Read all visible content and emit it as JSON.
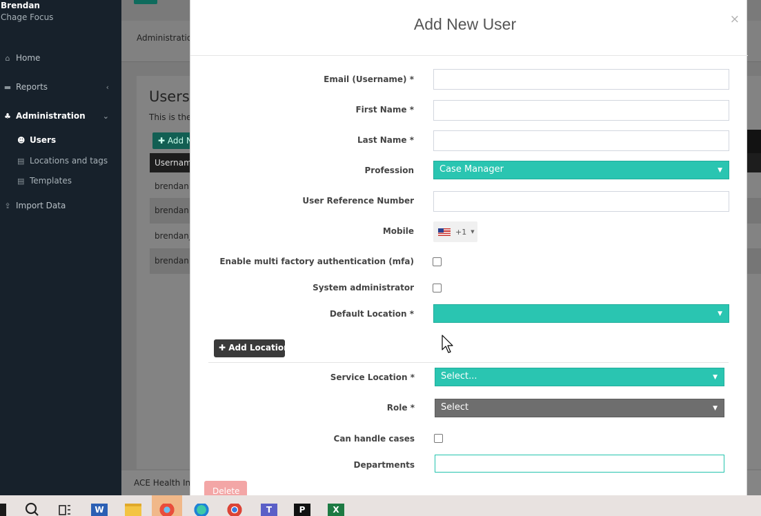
{
  "sidebar": {
    "user_name": "Brendan",
    "user_org": "Chage Focus",
    "nav": {
      "home": "Home",
      "reports": "Reports",
      "administration": "Administration",
      "import": "Import Data"
    },
    "sub": {
      "users": "Users",
      "locations": "Locations and tags",
      "templates": "Templates"
    }
  },
  "background": {
    "breadcrumb": "Administration",
    "page_title": "Users",
    "page_subtitle": "This is the",
    "add_button": "Add N",
    "table_header": "Usernam",
    "rows": [
      "brendan.",
      "brendan.",
      "brendanj",
      "brendan."
    ],
    "footer": "ACE Health Inn"
  },
  "modal": {
    "title": "Add New User",
    "close": "×",
    "labels": {
      "email": "Email (Username) *",
      "first_name": "First Name *",
      "last_name": "Last Name *",
      "profession": "Profession",
      "user_ref": "User Reference Number",
      "mobile": "Mobile",
      "mfa": "Enable multi factory authentication (mfa)",
      "sysadmin": "System administrator",
      "default_location": "Default Location *",
      "service_location": "Service Location *",
      "role": "Role *",
      "can_handle_cases": "Can handle cases",
      "departments": "Departments"
    },
    "values": {
      "email": "",
      "first_name": "",
      "last_name": "",
      "profession": "Case Manager",
      "user_ref": "",
      "mobile_code": "+1",
      "default_location": "",
      "service_location": "Select...",
      "role": "Select",
      "departments": ""
    },
    "add_location": "Add Location",
    "delete": "Delete"
  },
  "taskbar": {
    "word_letter": "W",
    "excel_letter": "X"
  },
  "colors": {
    "accent_teal": "#2ac5b1",
    "sidebar_bg": "#17212b",
    "delete_pink": "#f3a6a6"
  }
}
